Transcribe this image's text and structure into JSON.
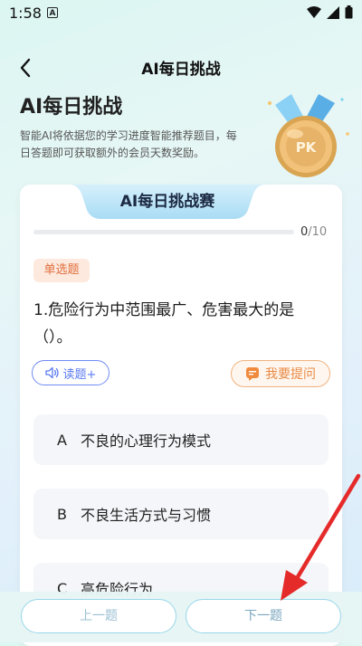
{
  "status_bar": {
    "time": "1:58",
    "notification_icon": "A"
  },
  "header": {
    "title": "AI每日挑战"
  },
  "hero": {
    "title": "AI每日挑战",
    "description": "智能AI将依据您的学习进度智能推荐题目，每日答题即可获取额外的会员天数奖励。",
    "medal_text": "PK"
  },
  "card": {
    "tab_title": "AI每日挑战赛"
  },
  "progress": {
    "current": "0",
    "total": "/10",
    "fraction": 0
  },
  "question": {
    "type": "单选题",
    "text": "1.危险行为中范围最广、危害最大的是（）。",
    "read_label": "读题+",
    "ask_label": "我要提问"
  },
  "options": [
    {
      "letter": "A",
      "text": "不良的心理行为模式"
    },
    {
      "letter": "B",
      "text": "不良生活方式与习惯"
    },
    {
      "letter": "C",
      "text": "高危险行为"
    }
  ],
  "footer": {
    "prev_label": "上一题",
    "next_label": "下一题"
  },
  "colors": {
    "accent_blue": "#5a7af0",
    "accent_orange": "#e88a45",
    "annotation_red": "#e52a2a"
  }
}
